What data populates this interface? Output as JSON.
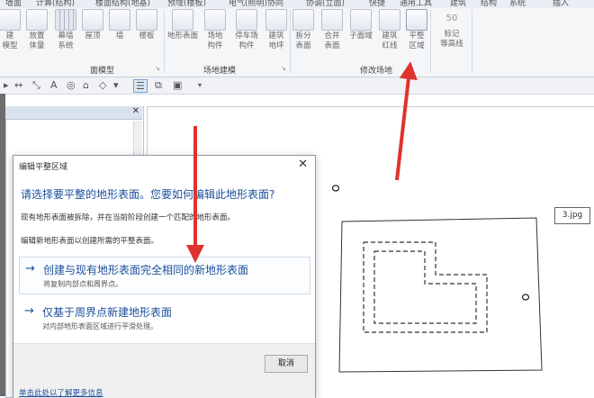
{
  "menu": {
    "items": [
      "墙面",
      "计算(结构)",
      "楼面结构(地基)",
      "预埋(楼板)",
      "电气(照明)协同",
      "协调(立面)",
      "快捷",
      "通用工具",
      "建筑",
      "结构",
      "系统",
      "插入"
    ]
  },
  "ribbon": {
    "buttons": [
      "建\n模型",
      "放置\n体量",
      "幕墙\n系统",
      "屋顶",
      "墙",
      "楼板",
      "地形表面",
      "场地\n构件",
      "停车场\n构件",
      "建筑\n地坪",
      "拆分\n表面",
      "合并\n表面",
      "子面域",
      "建筑\n红线",
      "平整\n区域",
      "标记\n等高线"
    ],
    "panels": {
      "massing": "面模型",
      "site_model": "场地建模",
      "modify_site": "修改场地"
    },
    "contour_value": "50"
  },
  "dialog": {
    "title": "编辑平整区域",
    "heading": "请选择要平整的地形表面。您要如何编辑此地形表面?",
    "text1": "现有地形表面被拆除，并在当前阶段创建一个匹配的地形表面。",
    "text2": "编辑新地形表面以创建所需的平整表面。",
    "option1_title": "创建与现有地形表面完全相同的新地形表面",
    "option1_sub": "将复制内部点和周界点。",
    "option2_title": "仅基于周界点新建地形表面",
    "option2_sub": "对内部地形表面区域进行平滑处理。",
    "cancel": "取消",
    "more_info": "单击此处以了解更多信息"
  },
  "canvas": {
    "image_label": "3.jpg"
  },
  "colors": {
    "arrow": "#e0322e",
    "link_blue": "#1a4f9c"
  }
}
